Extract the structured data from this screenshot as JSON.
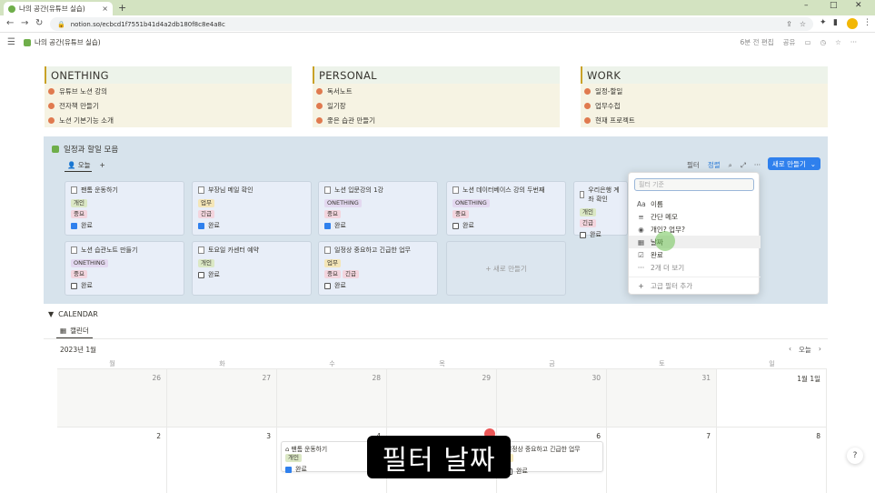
{
  "browser": {
    "tab_title": "나의 공간(유튜브 실습)",
    "tab_close": "×",
    "new_tab": "+",
    "url": "notion.so/ecbcd1f7551b41d4a2db180f8c8e4a8c",
    "win_min": "–",
    "win_max": "□",
    "win_close": "✕"
  },
  "notion_top": {
    "breadcrumb": "나의 공간(유튜브 실습)",
    "edited": "6분 전 편집",
    "share": "공유"
  },
  "columns": [
    {
      "title": "ONETHING",
      "items": [
        "유튜브 노션 강의",
        "전자책 만들기",
        "노션 기본기능 소개"
      ]
    },
    {
      "title": "PERSONAL",
      "items": [
        "독서노트",
        "일기장",
        "좋은 습관 만들기"
      ]
    },
    {
      "title": "WORK",
      "items": [
        "일정-할일",
        "업무수첩",
        "현재 프로젝트"
      ]
    }
  ],
  "gallery": {
    "title": "일정과 할일 모음",
    "view_tab": "오늘",
    "add_view": "+",
    "filter_label": "필터",
    "sort_label": "정렬",
    "new_button": "새로 만들기",
    "new_card": "+ 새로 만들기",
    "cards": [
      {
        "title": "팬톰 운동하기",
        "tags": [
          [
            "개인",
            "green"
          ],
          [
            "중요",
            "pink"
          ]
        ],
        "done_label": "완료",
        "done": true
      },
      {
        "title": "부장님 메일 확인",
        "tags": [
          [
            "업무",
            "yellow"
          ],
          [
            "긴급",
            "pink"
          ]
        ],
        "done_label": "완료",
        "done": true
      },
      {
        "title": "노션 입문강의 1강",
        "tags": [
          [
            "ONETHING",
            "purple"
          ],
          [
            "중요",
            "pink"
          ]
        ],
        "done_label": "완료",
        "done": true
      },
      {
        "title": "노션 데이터베이스 강의 두번째",
        "tags": [
          [
            "ONETHING",
            "purple"
          ],
          [
            "중요",
            "pink"
          ]
        ],
        "done_label": "완료",
        "done": false
      },
      {
        "title": "우리은행 계좌 확인",
        "tags": [
          [
            "개인",
            "green"
          ],
          [
            "긴급",
            "pink"
          ]
        ],
        "done_label": "완료",
        "done": false
      },
      {
        "title": "노션 습관노트 만들기",
        "tags": [
          [
            "ONETHING",
            "purple"
          ],
          [
            "중요",
            "pink"
          ]
        ],
        "done_label": "완료",
        "done": false
      },
      {
        "title": "토요일 카센터 예약",
        "tags": [
          [
            "개인",
            "green"
          ]
        ],
        "done_label": "완료",
        "done": false
      },
      {
        "title": "일정상 중요하고 긴급한 업무",
        "tags": [
          [
            "업무",
            "yellow"
          ],
          [
            "중요",
            "pink"
          ],
          [
            "긴급",
            "pink"
          ]
        ],
        "done_label": "완료",
        "done": false
      }
    ]
  },
  "filter_dropdown": {
    "placeholder": "필터 기준",
    "items": [
      {
        "icon": "Aa",
        "label": "이름"
      },
      {
        "icon": "≡",
        "label": "간단 메모"
      },
      {
        "icon": "◉",
        "label": "개인? 업무?"
      },
      {
        "icon": "▦",
        "label": "날짜"
      },
      {
        "icon": "☑",
        "label": "완료"
      },
      {
        "icon": "···",
        "label": "2개 더 보기"
      }
    ],
    "advanced": "고급 필터 추가"
  },
  "calendar": {
    "section": "CALENDAR",
    "view": "캘린더",
    "month": "2023년 1월",
    "today": "오늘",
    "weekdays": [
      "월",
      "화",
      "수",
      "목",
      "금",
      "토",
      "일"
    ],
    "row1": [
      "26",
      "27",
      "28",
      "29",
      "30",
      "31",
      "1월 1일"
    ],
    "row2": [
      "2",
      "3",
      "4",
      "5",
      "6",
      "7",
      "8"
    ],
    "events": {
      "e1_title": "팬톰 운동하기",
      "e1_tag": "개인",
      "e1_done": "완료",
      "e2_title": "일정상 중요하고 긴급한 업무",
      "e2_done": "완료"
    }
  },
  "subtitle": "필터 날짜",
  "help": "?"
}
